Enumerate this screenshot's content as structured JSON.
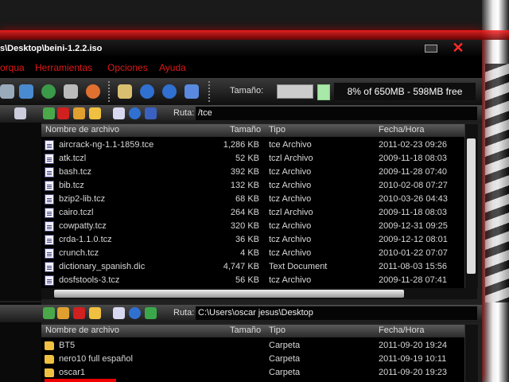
{
  "window": {
    "title": "s\\Desktop\\beini-1.2.2.iso"
  },
  "menu": [
    "orqua",
    "Herramientas",
    "Opciones",
    "Ayuda"
  ],
  "toolbar": {
    "size_label": "Tamaño:",
    "size_value": "",
    "free_space": "8% of 650MB - 598MB free"
  },
  "top_pane": {
    "ruta_label": "Ruta:",
    "ruta_value": "/tce",
    "columns": [
      "Nombre de archivo",
      "Tamaño",
      "Tipo",
      "Fecha/Hora"
    ],
    "rows": [
      {
        "name": "aircrack-ng-1.1-1859.tce",
        "size": "1,286 KB",
        "type": "tce Archivo",
        "date": "2011-02-23 09:26"
      },
      {
        "name": "atk.tczl",
        "size": "52 KB",
        "type": "tczl Archivo",
        "date": "2009-11-18 08:03"
      },
      {
        "name": "bash.tcz",
        "size": "392 KB",
        "type": "tcz Archivo",
        "date": "2009-11-28 07:40"
      },
      {
        "name": "bib.tcz",
        "size": "132 KB",
        "type": "tcz Archivo",
        "date": "2010-02-08 07:27"
      },
      {
        "name": "bzip2-lib.tcz",
        "size": "68 KB",
        "type": "tcz Archivo",
        "date": "2010-03-26 04:43"
      },
      {
        "name": "cairo.tczl",
        "size": "264 KB",
        "type": "tczl Archivo",
        "date": "2009-11-18 08:03"
      },
      {
        "name": "cowpatty.tcz",
        "size": "320 KB",
        "type": "tcz Archivo",
        "date": "2009-12-31 09:25"
      },
      {
        "name": "crda-1.1.0.tcz",
        "size": "36 KB",
        "type": "tcz Archivo",
        "date": "2009-12-12 08:01"
      },
      {
        "name": "crunch.tcz",
        "size": "4 KB",
        "type": "tcz Archivo",
        "date": "2010-01-22 07:07"
      },
      {
        "name": "dictionary_spanish.dic",
        "size": "4,747 KB",
        "type": "Text Document",
        "date": "2011-08-03 15:56"
      },
      {
        "name": "dosfstools-3.tcz",
        "size": "56 KB",
        "type": "tcz Archivo",
        "date": "2009-11-28 07:41"
      }
    ]
  },
  "bottom_pane": {
    "ruta_label": "Ruta:",
    "ruta_value": "C:\\Users\\oscar jesus\\Desktop",
    "columns": [
      "Nombre de archivo",
      "Tamaño",
      "Tipo",
      "Fecha/Hora"
    ],
    "rows": [
      {
        "name": "BT5",
        "size": "",
        "type": "Carpeta",
        "date": "2011-09-20 19:24"
      },
      {
        "name": "nero10 full español",
        "size": "",
        "type": "Carpeta",
        "date": "2011-09-19 10:11"
      },
      {
        "name": "oscar1",
        "size": "",
        "type": "Carpeta",
        "date": "2011-09-20 19:23"
      }
    ]
  },
  "colors": {
    "accent": "#e01818",
    "background": "#000000",
    "folder": "#f0c040"
  }
}
